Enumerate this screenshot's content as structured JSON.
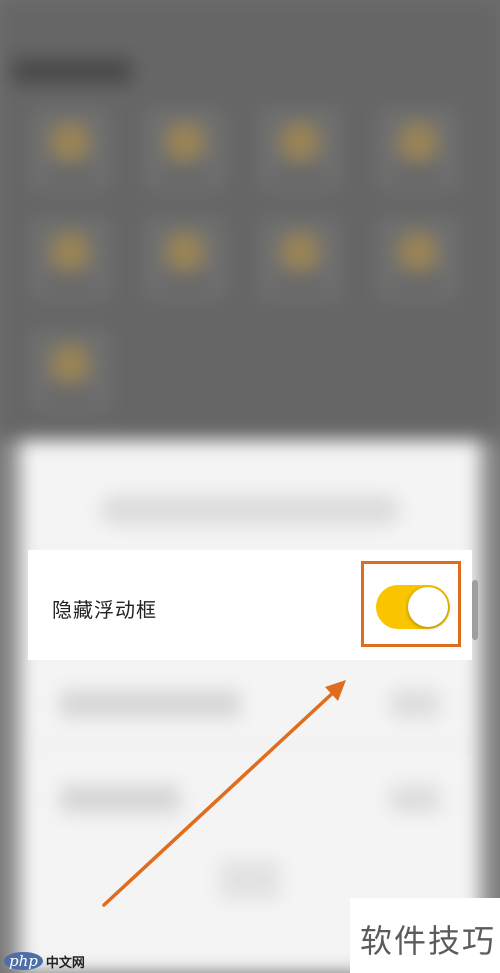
{
  "setting": {
    "label": "隐藏浮动框",
    "toggle_state": "on"
  },
  "colors": {
    "toggle_on": "#f9c500",
    "highlight": "#e06d1e",
    "arrow": "#e06d1e"
  },
  "watermark": {
    "right_text": "软件技巧",
    "left_logo": "php",
    "left_site": "中文网"
  }
}
